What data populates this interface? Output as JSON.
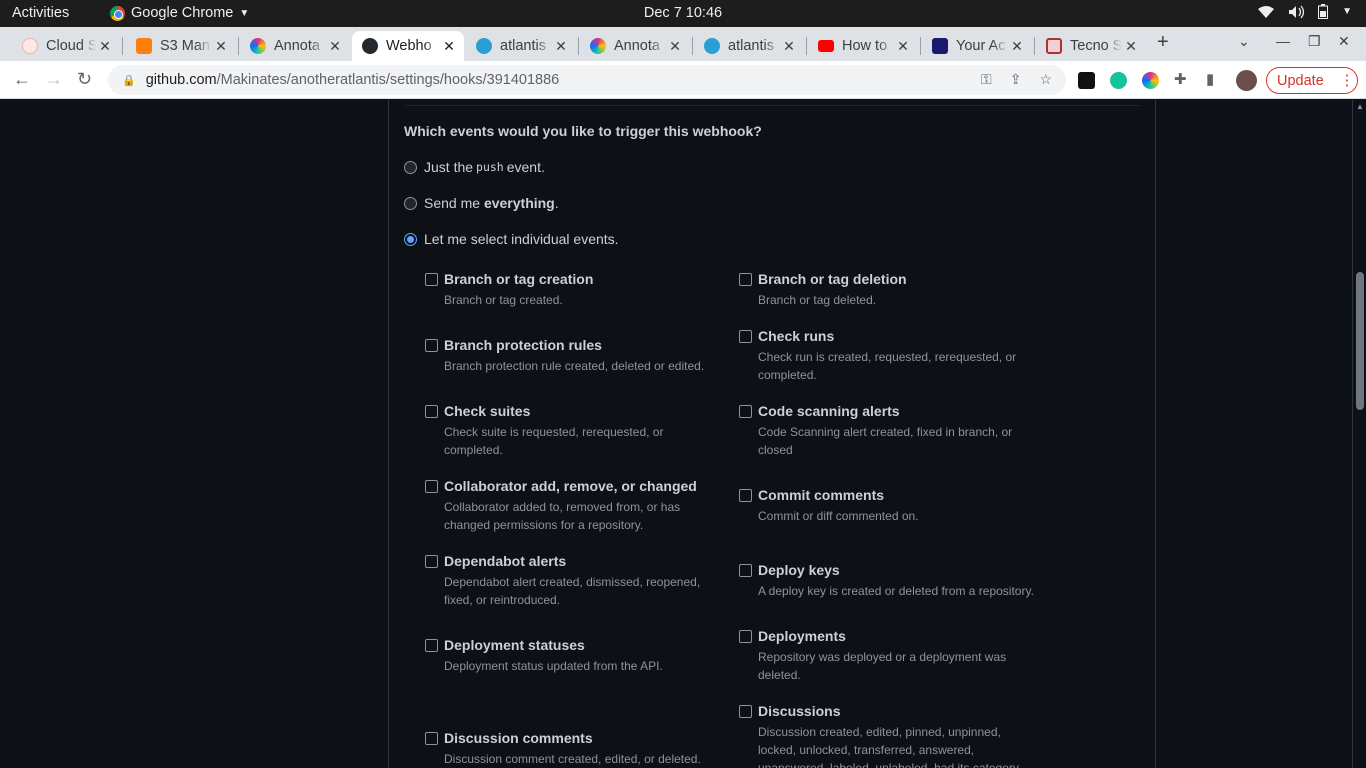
{
  "topbar": {
    "activities": "Activities",
    "app": "Google Chrome",
    "clock": "Dec 7  10:46"
  },
  "tabs": [
    {
      "label": "Cloud S",
      "color": "#f4b2a0",
      "icon": "cloud-icon"
    },
    {
      "label": "S3 Man",
      "color": "#ff7f0e",
      "icon": "aws-s3-icon"
    },
    {
      "label": "Annota",
      "color": "#d63384",
      "icon": "annotation-tool-icon"
    },
    {
      "label": "Webho",
      "color": "#24292f",
      "icon": "github-icon"
    },
    {
      "label": "atlantis",
      "color": "#2a9fd6",
      "icon": "atlantis-icon"
    },
    {
      "label": "Annota",
      "color": "#d63384",
      "icon": "annotation-tool-icon"
    },
    {
      "label": "atlantis",
      "color": "#2a9fd6",
      "icon": "atlantis-icon"
    },
    {
      "label": "How to",
      "color": "#ff0000",
      "icon": "youtube-icon"
    },
    {
      "label": "Your Ac",
      "color": "#1a1a6e",
      "icon": "notion-icon"
    },
    {
      "label": "Tecno S",
      "color": "#b03030",
      "icon": "tecno-icon"
    }
  ],
  "toolbar": {
    "url_host": "github.com",
    "url_path": "/Makinates/anotheratlantis/settings/hooks/391401886",
    "update_label": "Update"
  },
  "webhook": {
    "question": "Which events would you like to trigger this webhook?",
    "radio_push_prefix": "Just the",
    "radio_push_code": "push",
    "radio_push_suffix": "event.",
    "radio_everything_prefix": "Send me",
    "radio_everything_bold": "everything",
    "radio_everything_suffix": ".",
    "radio_individual": "Let me select individual events.",
    "selected_option": "individual",
    "events_left": [
      {
        "name": "Branch or tag creation",
        "desc": "Branch or tag created."
      },
      {
        "name": "Branch protection rules",
        "desc": "Branch protection rule created, deleted or edited."
      },
      {
        "name": "Check suites",
        "desc": "Check suite is requested, rerequested, or completed."
      },
      {
        "name": "Collaborator add, remove, or changed",
        "desc": "Collaborator added to, removed from, or has changed permissions for a repository."
      },
      {
        "name": "Dependabot alerts",
        "desc": "Dependabot alert created, dismissed, reopened, fixed, or reintroduced."
      },
      {
        "name": "Deployment statuses",
        "desc": "Deployment status updated from the API."
      },
      {
        "name": "Discussion comments",
        "desc": "Discussion comment created, edited, or deleted."
      }
    ],
    "events_right": [
      {
        "name": "Branch or tag deletion",
        "desc": "Branch or tag deleted."
      },
      {
        "name": "Check runs",
        "desc": "Check run is created, requested, rerequested, or completed."
      },
      {
        "name": "Code scanning alerts",
        "desc": "Code Scanning alert created, fixed in branch, or closed"
      },
      {
        "name": "Commit comments",
        "desc": "Commit or diff commented on."
      },
      {
        "name": "Deploy keys",
        "desc": "A deploy key is created or deleted from a repository."
      },
      {
        "name": "Deployments",
        "desc": "Repository was deployed or a deployment was deleted."
      },
      {
        "name": "Discussions",
        "desc": "Discussion created, edited, pinned, unpinned, locked, unlocked, transferred, answered, unanswered, labeled, unlabeled, had its category"
      }
    ]
  }
}
